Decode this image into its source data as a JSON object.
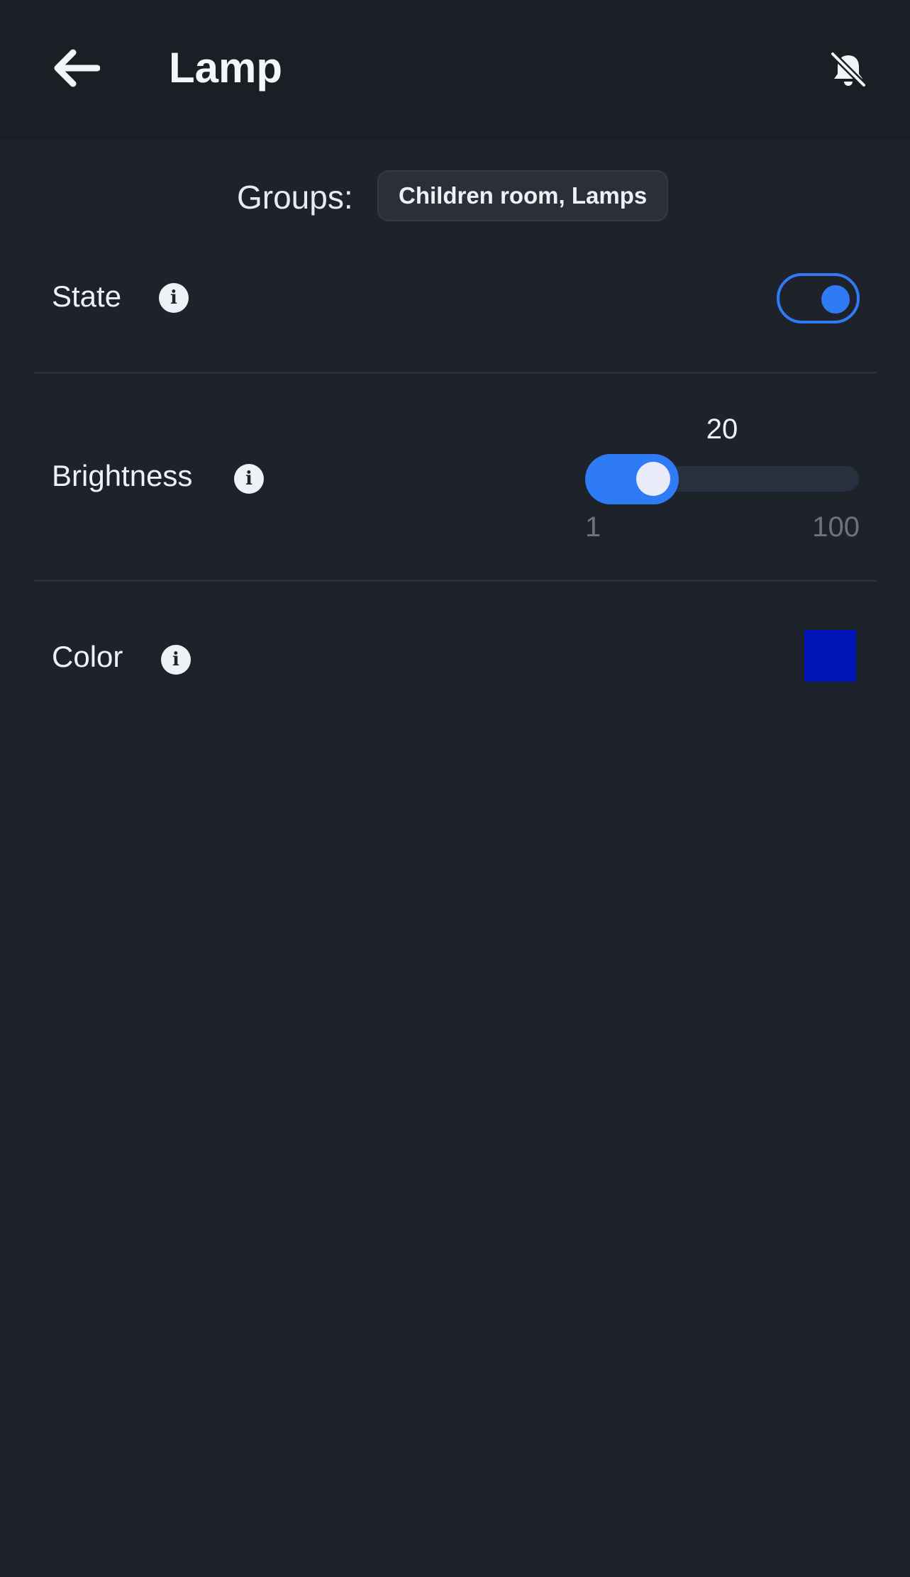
{
  "header": {
    "title": "Lamp",
    "back_icon": "arrow-left-icon",
    "notifications_icon": "bell-off-icon"
  },
  "groups": {
    "label": "Groups:",
    "value": "Children room, Lamps"
  },
  "controls": {
    "state": {
      "label": "State",
      "on": true
    },
    "brightness": {
      "label": "Brightness",
      "value": "20",
      "min": "1",
      "max": "100"
    },
    "color": {
      "label": "Color",
      "value": "#0016b8"
    }
  },
  "colors": {
    "background": "#1e232b",
    "header_background": "#1a1e25",
    "accent": "#2f7bf5",
    "selected_color": "#0016b8"
  }
}
